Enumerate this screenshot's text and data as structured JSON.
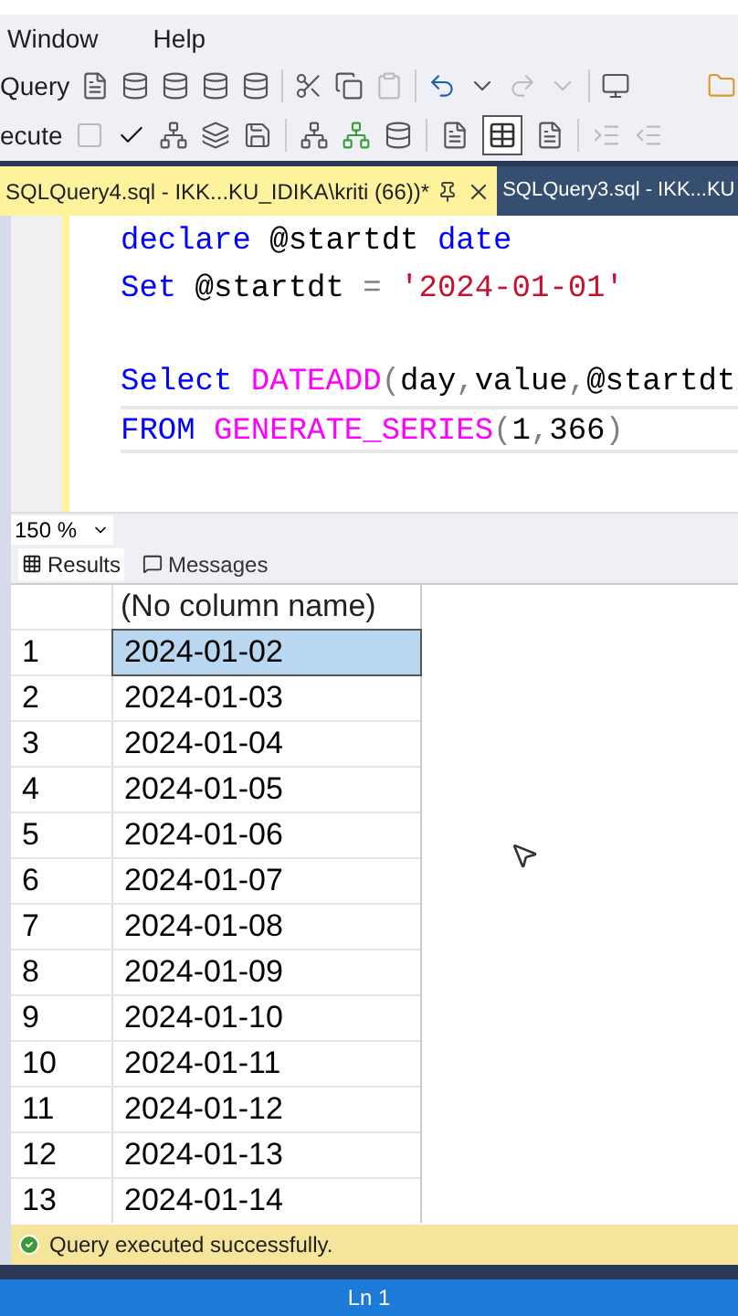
{
  "menu": [
    {
      "label": "Window"
    },
    {
      "label": "Help"
    }
  ],
  "toolbar_1": {
    "label": "Query"
  },
  "toolbar_2": {
    "label": "ecute"
  },
  "tabs": [
    {
      "label": "SQLQuery4.sql - IKK...KU_IDIKA\\kriti (66))*",
      "selected": true
    },
    {
      "label": "SQLQuery3.sql - IKK...KU",
      "selected": false
    }
  ],
  "editor": {
    "lines": [
      {
        "gap_before": false,
        "tokens": [
          {
            "kind": "keyword",
            "text": "declare"
          },
          {
            "kind": "plain",
            "text": " @startdt "
          },
          {
            "kind": "keyword",
            "text": "date"
          }
        ]
      },
      {
        "gap_before": false,
        "tokens": [
          {
            "kind": "keyword",
            "text": "Set"
          },
          {
            "kind": "plain",
            "text": " @startdt "
          },
          {
            "kind": "punct",
            "text": "="
          },
          {
            "kind": "string",
            "text": " '2024-01-01'"
          }
        ]
      },
      {
        "gap_before": true,
        "tokens": [
          {
            "kind": "keyword",
            "text": "Select"
          },
          {
            "kind": "function",
            "text": " DATEADD"
          },
          {
            "kind": "punct",
            "text": "("
          },
          {
            "kind": "plain",
            "text": "day"
          },
          {
            "kind": "punct",
            "text": ","
          },
          {
            "kind": "plain",
            "text": "value"
          },
          {
            "kind": "punct",
            "text": ","
          },
          {
            "kind": "plain",
            "text": "@startdt"
          }
        ]
      },
      {
        "gap_before": false,
        "tokens": [
          {
            "kind": "keyword",
            "text": "FROM"
          },
          {
            "kind": "function",
            "text": " GENERATE_SERIES"
          },
          {
            "kind": "punct",
            "text": "("
          },
          {
            "kind": "plain",
            "text": "1"
          },
          {
            "kind": "punct",
            "text": ","
          },
          {
            "kind": "plain",
            "text": "366"
          },
          {
            "kind": "punct",
            "text": ")"
          }
        ]
      }
    ]
  },
  "zoom": "150 %",
  "result_tabs": [
    {
      "label": "Results",
      "selected": true
    },
    {
      "label": "Messages",
      "selected": false
    }
  ],
  "table": {
    "columns": [
      "(No column name)"
    ],
    "rows": [
      {
        "n": "1",
        "value": "2024-01-02",
        "selected": true
      },
      {
        "n": "2",
        "value": "2024-01-03",
        "selected": false
      },
      {
        "n": "3",
        "value": "2024-01-04",
        "selected": false
      },
      {
        "n": "4",
        "value": "2024-01-05",
        "selected": false
      },
      {
        "n": "5",
        "value": "2024-01-06",
        "selected": false
      },
      {
        "n": "6",
        "value": "2024-01-07",
        "selected": false
      },
      {
        "n": "7",
        "value": "2024-01-08",
        "selected": false
      },
      {
        "n": "8",
        "value": "2024-01-09",
        "selected": false
      },
      {
        "n": "9",
        "value": "2024-01-10",
        "selected": false
      },
      {
        "n": "10",
        "value": "2024-01-11",
        "selected": false
      },
      {
        "n": "11",
        "value": "2024-01-12",
        "selected": false
      },
      {
        "n": "12",
        "value": "2024-01-13",
        "selected": false
      },
      {
        "n": "13",
        "value": "2024-01-14",
        "selected": false
      }
    ]
  },
  "query_status": "Query executed successfully.",
  "status_bar": "Ln 1"
}
